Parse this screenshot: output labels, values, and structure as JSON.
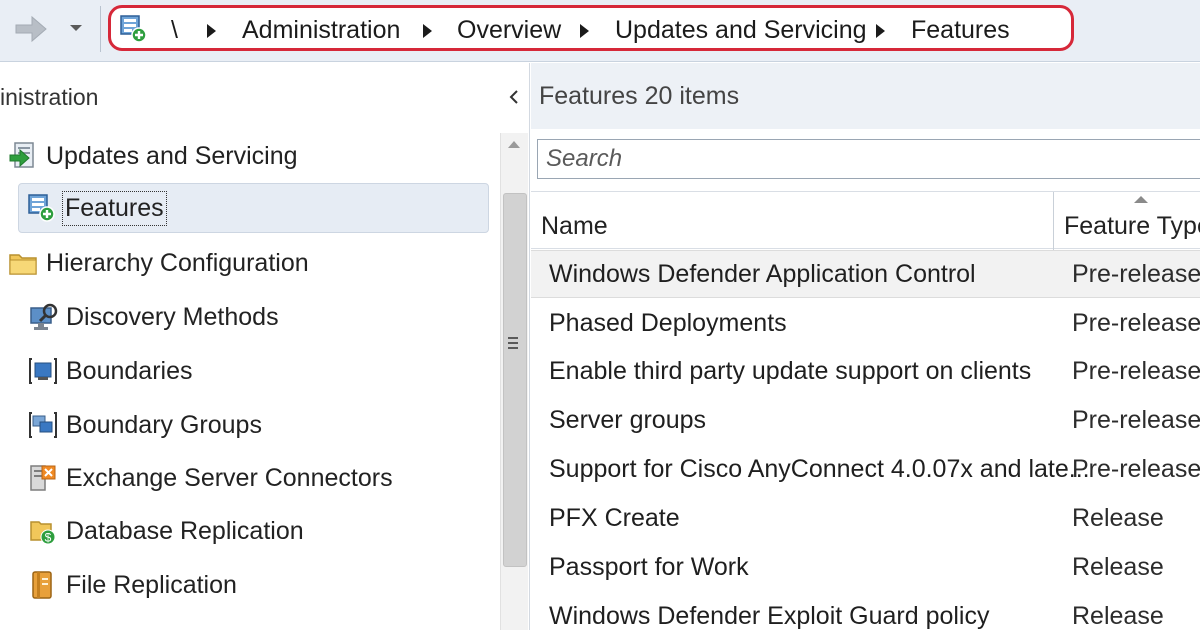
{
  "breadcrumb": {
    "root": "\\",
    "items": [
      "Administration",
      "Overview",
      "Updates and Servicing",
      "Features"
    ]
  },
  "left_pane": {
    "title": "inistration",
    "items": [
      {
        "label": "Updates and Servicing",
        "icon": "updates-servicing-icon"
      },
      {
        "label": "Features",
        "icon": "features-icon",
        "selected": true
      },
      {
        "label": "Hierarchy Configuration",
        "icon": "folder-icon"
      },
      {
        "label": "Discovery Methods",
        "icon": "discovery-methods-icon"
      },
      {
        "label": "Boundaries",
        "icon": "boundaries-icon"
      },
      {
        "label": "Boundary Groups",
        "icon": "boundary-groups-icon"
      },
      {
        "label": "Exchange Server Connectors",
        "icon": "exchange-connector-icon"
      },
      {
        "label": "Database Replication",
        "icon": "database-replication-icon"
      },
      {
        "label": "File Replication",
        "icon": "file-replication-icon"
      }
    ]
  },
  "right_pane": {
    "title": "Features 20 items",
    "search_placeholder": "Search",
    "columns": [
      "Name",
      "Feature Type"
    ],
    "rows": [
      {
        "name": "Windows Defender Application Control",
        "type": "Pre-release"
      },
      {
        "name": "Phased Deployments",
        "type": "Pre-release"
      },
      {
        "name": "Enable third party update support on clients",
        "type": "Pre-release"
      },
      {
        "name": "Server groups",
        "type": "Pre-release"
      },
      {
        "name": "Support for Cisco AnyConnect 4.0.07x and late...",
        "type": "Pre-release"
      },
      {
        "name": "PFX Create",
        "type": "Release"
      },
      {
        "name": "Passport for Work",
        "type": "Release"
      },
      {
        "name": "Windows Defender Exploit Guard policy",
        "type": "Release"
      }
    ]
  },
  "colors": {
    "highlight_border": "#d62839",
    "topbar_bg": "#e9eef5",
    "selected_bg": "#e6ecf4",
    "icon_green": "#2e9e3e",
    "icon_blue": "#3a78c2",
    "folder_yellow": "#f1c75a"
  }
}
